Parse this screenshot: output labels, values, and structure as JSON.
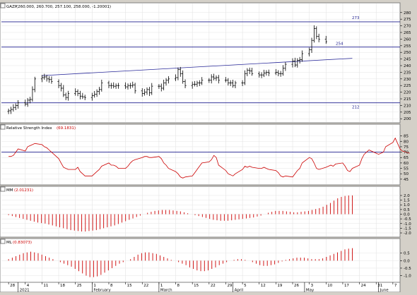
{
  "colors": {
    "background": "#ffffff",
    "frame": "#808080",
    "grid": "#e4e4e4",
    "price_bar": "#000000",
    "level_line": "#1f1f8f",
    "trend_line": "#2a2a9a",
    "indicator": "#cc0000",
    "header_value": "#cc0000",
    "axis_text": "#000000",
    "level_text": "#1f1f8f"
  },
  "panels": [
    {
      "id": "price",
      "title": "GAZP",
      "params": "(260.000, 260.700, 257.100, 258.000, -1.20001)",
      "ticks": [
        "280",
        "275",
        "270",
        "265",
        "260",
        "255",
        "250",
        "245",
        "240",
        "235",
        "230",
        "225",
        "220",
        "215",
        "210",
        "205",
        "200"
      ]
    },
    {
      "id": "rsi",
      "title": "Relative Strength Index",
      "params": "(69.1831)",
      "ticks": [
        "85",
        "80",
        "75",
        "70",
        "65",
        "60",
        "55",
        "50",
        "45"
      ]
    },
    {
      "id": "mm",
      "title": "MM",
      "params": "(2.01231)",
      "ticks": [
        "2.0",
        "1.5",
        "1.0",
        "0.5",
        "0.0",
        "-0.5",
        "-1.0",
        "-1.5",
        "-2.0"
      ]
    },
    {
      "id": "ml",
      "title": "ML",
      "params": "(0.83073)",
      "ticks": [
        "0.5",
        "0.0",
        "-0.5",
        "-1.0"
      ]
    }
  ],
  "x_axis": {
    "day_labels": [
      "28",
      "4",
      "11",
      "18",
      "25",
      "1",
      "8",
      "15",
      "22",
      "1",
      "8",
      "15",
      "22",
      "29",
      "5",
      "12",
      "19",
      "26",
      "3",
      "10",
      "17",
      "24",
      "31",
      "7"
    ],
    "month_labels": [
      "2021",
      "February",
      "March",
      "April",
      "May",
      "June"
    ]
  },
  "chart_data": [
    {
      "type": "ohlc",
      "title": "GAZP (260.000, 260.700, 257.100, 258.000, -1.20001)",
      "ylim": [
        198,
        282
      ],
      "x_range": [
        "2020-12-25",
        "2021-06-10"
      ],
      "grid": true,
      "close": [
        206,
        207,
        208.5,
        210,
        212,
        211,
        214,
        214.5,
        222,
        230,
        231,
        231.5,
        230,
        229.5,
        228,
        225,
        223,
        218,
        216,
        219,
        220.5,
        219,
        217,
        216.5,
        216,
        217.5,
        218.5,
        220.5,
        222,
        227,
        225,
        225,
        224.5,
        225,
        225,
        224,
        225,
        225,
        225.5,
        221,
        219,
        220,
        222,
        219.5,
        224.5,
        224.5,
        223,
        227,
        229,
        230,
        231,
        237,
        234,
        228,
        225,
        226,
        226,
        227,
        227,
        229,
        229,
        231.5,
        230.5,
        231,
        229,
        229,
        227,
        227,
        225,
        227,
        227,
        234,
        236.5,
        236,
        234,
        233,
        233,
        234.5,
        235,
        234.5,
        235,
        234,
        234,
        238,
        241,
        243.5,
        240.5,
        244,
        244.5,
        249,
        252,
        259,
        268,
        262,
        260,
        258
      ],
      "horizontal_lines": [
        {
          "label": "273",
          "y": 273
        },
        {
          "label": "254",
          "y": 254
        },
        {
          "label": "212",
          "y": 212
        }
      ],
      "trend_line": {
        "start": {
          "date": "2021-01-11",
          "y": 232.5
        },
        "end": {
          "date": "2021-05-21",
          "y": 245.5
        }
      }
    },
    {
      "type": "line",
      "title": "Relative Strength Index (69.1831)",
      "ylim": [
        41,
        88
      ],
      "reference_line": 70,
      "values": [
        66,
        66,
        67,
        70,
        73,
        71,
        75,
        76,
        77,
        78,
        77,
        75,
        74,
        72,
        70,
        64,
        60,
        56,
        55,
        54,
        54,
        56,
        52,
        50,
        48,
        48,
        50,
        52,
        54,
        57,
        60,
        58,
        58,
        57,
        55,
        55,
        57,
        60,
        62,
        63,
        65,
        66,
        66,
        65,
        65,
        66,
        64,
        60,
        58,
        55,
        52,
        50,
        47,
        46,
        47,
        48,
        51,
        54,
        57,
        60,
        61,
        63,
        67,
        65,
        58,
        53,
        50,
        49,
        48,
        50,
        54,
        57,
        56,
        57,
        56,
        55,
        55,
        56,
        55,
        54,
        53,
        51,
        48,
        47,
        48,
        47,
        50,
        53,
        55,
        60,
        65,
        64,
        60,
        55,
        54,
        56,
        57,
        58,
        57,
        59,
        60,
        57,
        53,
        52,
        55,
        58,
        64,
        68,
        70,
        72,
        69,
        68,
        69,
        70,
        75,
        79,
        83,
        78,
        73,
        71,
        69
      ]
    },
    {
      "type": "bar",
      "title": "MM (2.01231)",
      "ylim": [
        -2.3,
        2.3
      ],
      "values": [
        -0.1,
        -0.2,
        -0.3,
        -0.4,
        -0.5,
        -0.6,
        -0.7,
        -0.8,
        -0.9,
        -0.95,
        -1.0,
        -1.1,
        -1.2,
        -1.3,
        -1.4,
        -1.5,
        -1.6,
        -1.7,
        -1.75,
        -1.8,
        -1.85,
        -1.85,
        -1.8,
        -1.75,
        -1.7,
        -1.6,
        -1.5,
        -1.4,
        -1.3,
        -1.2,
        -1.05,
        -0.9,
        -0.75,
        -0.6,
        -0.45,
        -0.3,
        -0.15,
        0.0,
        0.15,
        0.25,
        0.35,
        0.4,
        0.45,
        0.45,
        0.45,
        0.4,
        0.35,
        0.3,
        0.2,
        0.1,
        0.0,
        -0.1,
        -0.2,
        -0.3,
        -0.4,
        -0.5,
        -0.6,
        -0.65,
        -0.7,
        -0.7,
        -0.7,
        -0.65,
        -0.6,
        -0.55,
        -0.5,
        -0.45,
        -0.4,
        -0.35,
        -0.25,
        -0.15,
        0.0,
        0.15,
        0.25,
        0.35,
        0.35,
        0.35,
        0.3,
        0.25,
        0.2,
        0.2,
        0.25,
        0.3,
        0.35,
        0.45,
        0.55,
        0.65,
        0.8,
        1.0,
        1.2,
        1.45,
        1.7,
        1.85,
        1.95,
        2.0,
        2.01
      ]
    },
    {
      "type": "bar",
      "title": "ML (0.83073)",
      "ylim": [
        -1.35,
        1.05
      ],
      "values": [
        0.1,
        0.2,
        0.3,
        0.4,
        0.5,
        0.55,
        0.6,
        0.55,
        0.5,
        0.4,
        0.3,
        0.2,
        0.1,
        0.0,
        -0.1,
        -0.2,
        -0.3,
        -0.4,
        -0.55,
        -0.7,
        -0.85,
        -1.0,
        -1.1,
        -1.1,
        -1.05,
        -0.95,
        -0.8,
        -0.65,
        -0.5,
        -0.35,
        -0.2,
        -0.1,
        0.0,
        0.1,
        0.25,
        0.4,
        0.5,
        0.55,
        0.55,
        0.5,
        0.45,
        0.35,
        0.25,
        0.15,
        0.05,
        0.0,
        -0.1,
        -0.2,
        -0.3,
        -0.45,
        -0.55,
        -0.65,
        -0.7,
        -0.7,
        -0.65,
        -0.55,
        -0.45,
        -0.3,
        -0.2,
        -0.1,
        0.0,
        0.05,
        0.1,
        0.1,
        0.05,
        0.0,
        -0.1,
        -0.2,
        -0.3,
        -0.35,
        -0.35,
        -0.3,
        -0.25,
        -0.15,
        -0.05,
        0.05,
        0.1,
        0.15,
        0.2,
        0.2,
        0.2,
        0.15,
        0.1,
        0.1,
        0.1,
        0.15,
        0.25,
        0.35,
        0.45,
        0.55,
        0.65,
        0.75,
        0.8,
        0.83
      ]
    }
  ]
}
